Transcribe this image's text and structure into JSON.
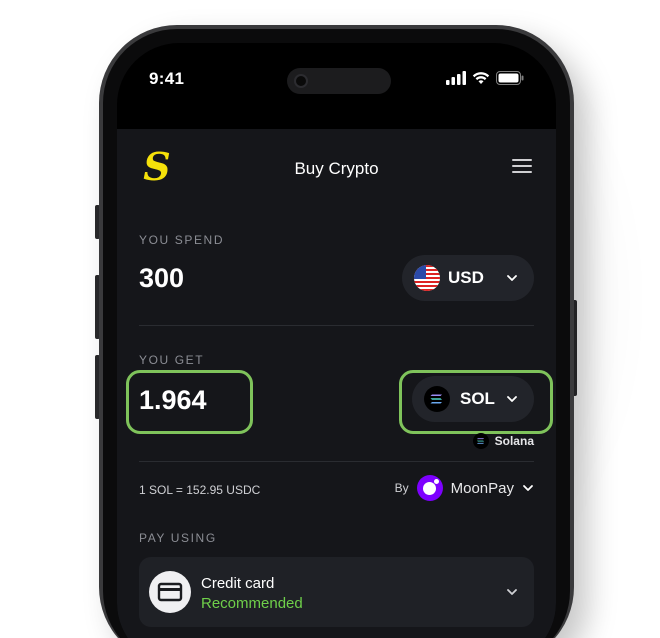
{
  "status_bar": {
    "time": "9:41"
  },
  "header": {
    "title": "Buy Crypto"
  },
  "spend": {
    "label": "YOU SPEND",
    "amount": "300",
    "currency": "USD"
  },
  "get": {
    "label": "YOU GET",
    "amount": "1.964",
    "currency": "SOL",
    "network": "Solana"
  },
  "rate": {
    "text": "1 SOL = 152.95 USDC"
  },
  "provider": {
    "by_label": "By",
    "name": "MoonPay"
  },
  "pay": {
    "label": "PAY USING",
    "method": "Credit card",
    "tag": "Recommended"
  },
  "colors": {
    "highlight": "#7fc35b",
    "recommended": "#6fd04a",
    "logo_yellow": "#f5e10a",
    "moonpay_purple": "#7d00ff"
  },
  "icons": {
    "logo": "s-logo-icon",
    "menu": "hamburger-menu-icon",
    "flag": "us-flag-icon",
    "sol": "solana-icon",
    "card": "credit-card-icon",
    "chevron": "chevron-down-icon"
  }
}
